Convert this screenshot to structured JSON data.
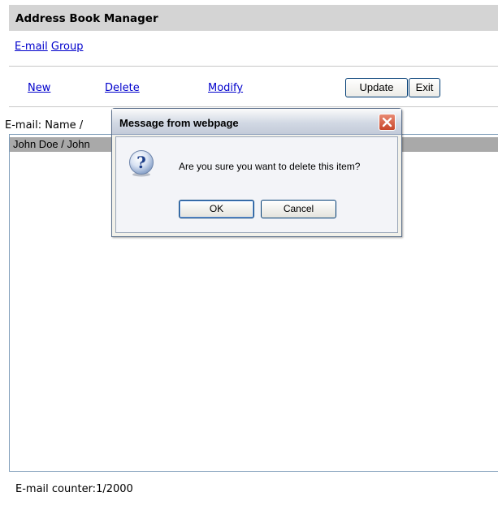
{
  "header": {
    "title": "Address Book Manager"
  },
  "tabs": [
    {
      "label": "E-mail"
    },
    {
      "label": "Group"
    }
  ],
  "toolbar": {
    "new_label": "New",
    "delete_label": "Delete",
    "modify_label": "Modify",
    "update_label": "Update",
    "exit_label": "Exit"
  },
  "list": {
    "header": "E-mail: Name /",
    "rows": [
      {
        "text": "John Doe / John",
        "selected": true
      }
    ]
  },
  "footer": {
    "counter_label": "E-mail counter:",
    "counter_value": "1/2000"
  },
  "dialog": {
    "title": "Message from webpage",
    "icon": "question-icon",
    "message": "Are you sure you want to delete this item?",
    "ok_label": "OK",
    "cancel_label": "Cancel"
  },
  "colors": {
    "link": "#0000cc",
    "header_bg": "#d4d4d4",
    "selected_row": "#a9a9a9",
    "close_button": "#c8462a"
  }
}
